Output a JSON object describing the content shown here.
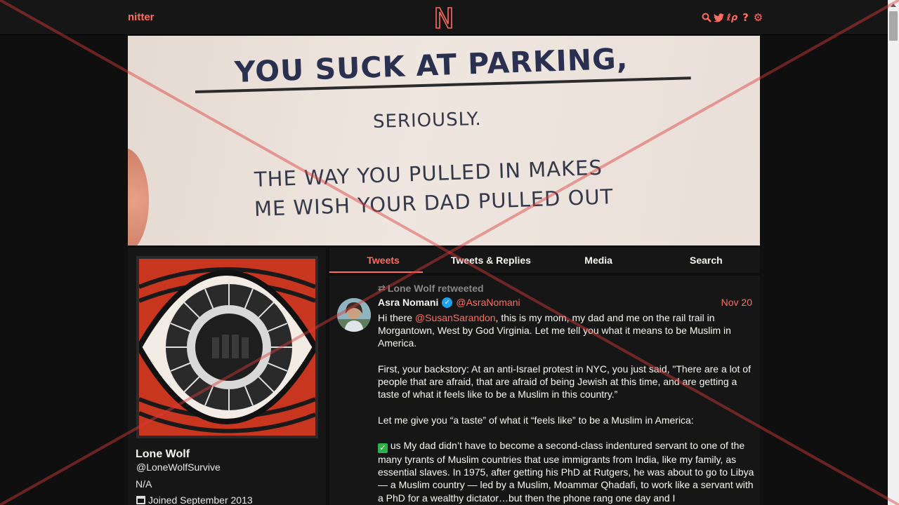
{
  "navbar": {
    "brand": "nitter",
    "icons": [
      "search-icon",
      "twitter-icon",
      "lp-icon",
      "help-icon",
      "gear-icon"
    ],
    "icon_glyphs": [
      "⌕",
      "🐦",
      "ℓρ",
      "?",
      "⚙"
    ]
  },
  "banner": {
    "line1": "YOU SUCK AT PARKING,",
    "line2": "SERIOUSLY.",
    "line3": "THE WAY YOU PULLED IN MAKES",
    "line4": "ME WISH YOUR DAD PULLED OUT"
  },
  "profile": {
    "name": "Lone Wolf",
    "handle": "@LoneWolfSurvive",
    "bio": "N/A",
    "joined": "Joined September 2013"
  },
  "tabs": [
    "Tweets",
    "Tweets & Replies",
    "Media",
    "Search"
  ],
  "tweet": {
    "retweet_header": "Lone Wolf retweeted",
    "author_name": "Asra Nomani",
    "author_handle": "@AsraNomani",
    "date": "Nov 20",
    "p1_pre": "Hi there ",
    "p1_mention": "@SusanSarandon",
    "p1_post": ", this is my mom, my dad and me on the rail trail in Morgantown, West by God Virginia. Let me tell you what it means to be Muslim in America.",
    "p2": "First, your backstory: At an anti-Israel protest in NYC, you just said, \"There are a lot of people that are afraid, that are afraid of being Jewish at this time, and are getting a taste of what it feels like to be a Muslim in this country.”",
    "p3": "Let me give you “a taste” of what it “feels like” to be a Muslim in America:",
    "p4_flag": "us",
    "p4": " My dad didn’t have to become a second-class indentured servant to one of the many tyrants of Muslim countries that use immigrants from India, like my family, as essential slaves. In 1975, after getting his PhD at Rutgers, he was about to go to Libya — a Muslim country — led by a Muslim, Moammar Qhadafi, to work like a servant with a PhD for a wealthy dictator…but then the phone rang one day and I"
  },
  "colors": {
    "accent": "#ff6c60",
    "background": "#0f0f0f",
    "panel": "#161616"
  }
}
